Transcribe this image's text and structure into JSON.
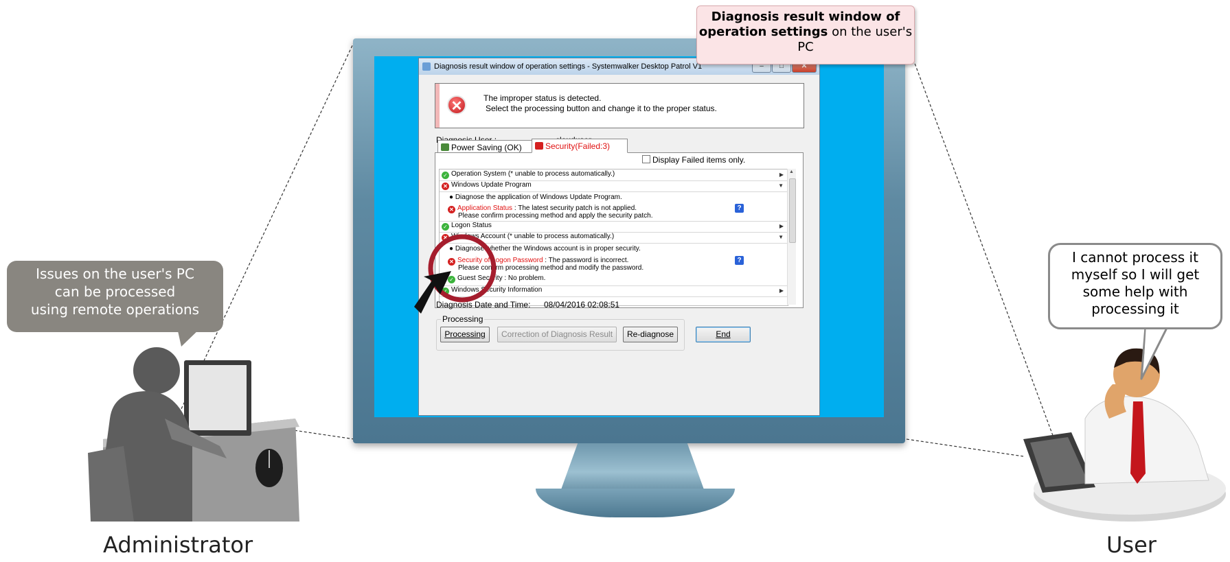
{
  "callouts": {
    "top_bold": "Diagnosis result window of operation settings",
    "top_normal": "on the user's PC",
    "admin_bubble": [
      "Issues on the user's PC",
      "can be processed",
      "using remote operations"
    ],
    "user_bubble": [
      "I cannot process it",
      "myself so I will get",
      "some help with",
      "processing it"
    ]
  },
  "captions": {
    "admin": "Administrator",
    "user": "User"
  },
  "window": {
    "title": "Diagnosis result window of operation settings - Systemwalker Desktop Patrol V1",
    "message_line1": "The improper status is detected.",
    "message_line2": "Select the processing button and change it to the proper status.",
    "user_label": "Diagnosis User :",
    "user_value": "clouduser",
    "tabs": [
      "Power Saving (OK)",
      "Security(Failed:3)"
    ],
    "filter_label": "Display Failed items only.",
    "rows": [
      "Operation System (* unable to process automatically.)",
      "Windows Update Program",
      "Diagnose the application of Windows Update Program.",
      "Application Status",
      " : The latest security patch is not applied.",
      "Please confirm processing method and apply the security patch.",
      "Logon Status",
      "Windows Account (* unable to process automatically.)",
      "Diagnose whether the Windows account is in proper security.",
      "Security of Logon Password",
      " : The password is incorrect.",
      "Please confirm processing method and modify the password.",
      "Guest Security",
      " : No problem.",
      "Windows Security Information"
    ],
    "date_label": "Diagnosis Date and Time:",
    "date_value": "08/04/2016 02:08:51",
    "processing_group": "Processing",
    "buttons": {
      "processing": "Processing",
      "correction": "Correction of Diagnosis Result",
      "rediagnose": "Re-diagnose",
      "end": "End"
    }
  },
  "colors": {
    "screen": "#00aeef",
    "error_red": "#e01010",
    "ok_green": "#3cb33c",
    "highlight_circle": "#a51d2d"
  }
}
